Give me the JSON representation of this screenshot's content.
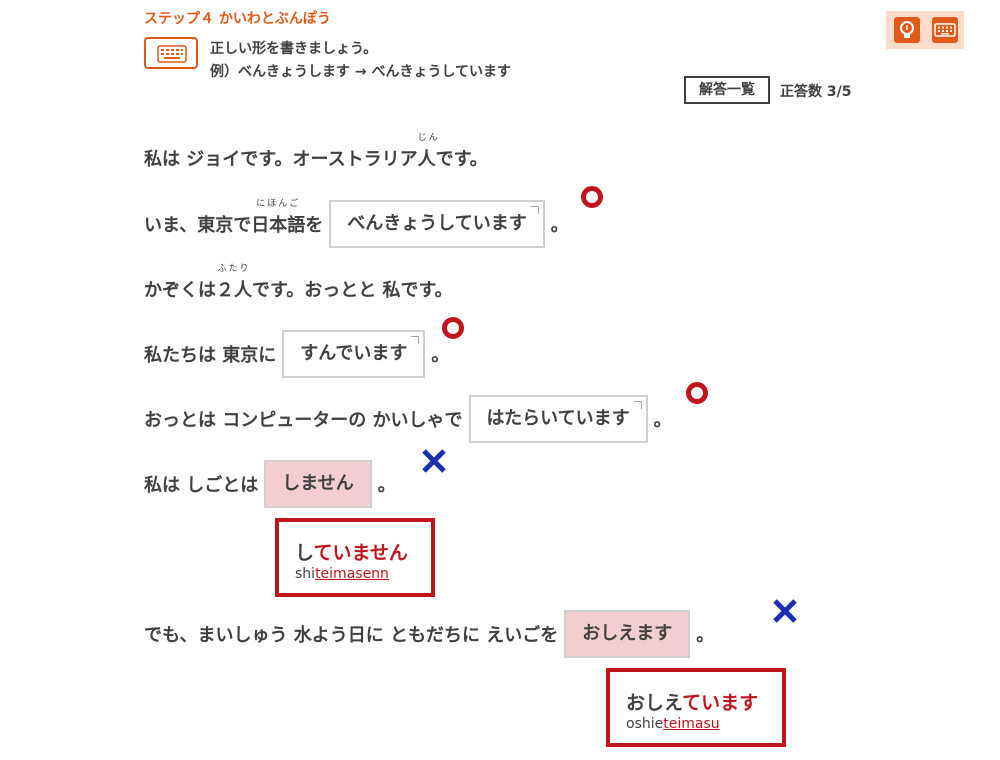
{
  "header": {
    "step_title": "ステップ４ かいわとぶんぽう",
    "instruction": "正しい形を書きましょう。",
    "example": "例）べんきょうします → べんきょうしています",
    "answers_button": "解答一覧",
    "score": "正答数 3/5",
    "icons": [
      "keyboard-icon",
      "lightbulb-icon",
      "keyboard-icon"
    ]
  },
  "colors": {
    "accent": "#e05a1a",
    "correct": "#c0141c",
    "wrong_mark": "#1a2fb0",
    "wrong_bg": "#f3cdcf"
  },
  "sentences": [
    {
      "pre": "私は ジョイです。オーストラリア",
      "ruby_base": "人",
      "ruby_text": "じん",
      "post": "です。"
    },
    {
      "pre1": "いま、東京で ",
      "ruby_base": "日本語",
      "ruby_text": "にほんご",
      "pre2": "を",
      "answer": "べんきょうしています",
      "post": "。",
      "result": "correct"
    },
    {
      "pre": "かぞくは ",
      "ruby_base": "２人",
      "ruby_text": "ふたり",
      "post": "です。おっとと 私です。"
    },
    {
      "pre": "私たちは 東京に",
      "answer": "すんでいます",
      "post": "。",
      "result": "correct"
    },
    {
      "pre": "おっとは コンピューターの かいしゃで",
      "answer": "はたらいています",
      "post": "。",
      "result": "correct"
    },
    {
      "pre": "私は しごとは",
      "answer": "しません",
      "post": "。",
      "result": "wrong",
      "correction": {
        "stem": "し",
        "ending": "ていません",
        "roma_stem": "shi",
        "roma_ending": "teimasenn"
      }
    },
    {
      "pre": "でも、まいしゅう 水よう日に ともだちに えいごを",
      "answer": "おしえます",
      "post": "。",
      "result": "wrong",
      "correction": {
        "stem": "おしえ",
        "ending": "ています",
        "roma_stem": "oshie",
        "roma_ending": "teimasu"
      }
    }
  ]
}
